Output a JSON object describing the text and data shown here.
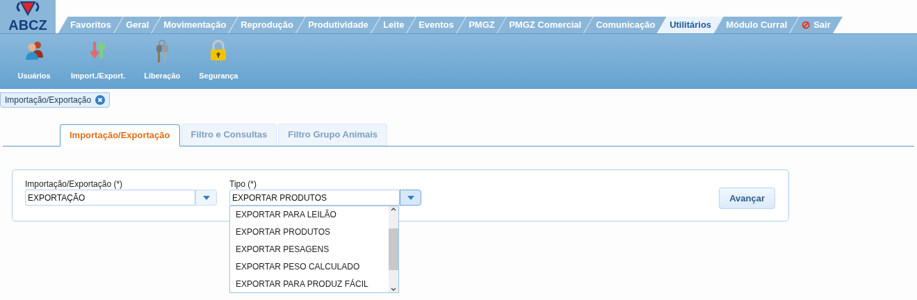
{
  "logo": {
    "text": "ABCZ"
  },
  "menu_tabs": [
    {
      "label": "Favoritos",
      "selected": false,
      "kind": "plain"
    },
    {
      "label": "Geral",
      "selected": false,
      "kind": "plain"
    },
    {
      "label": "Movimentação",
      "selected": false,
      "kind": "plain"
    },
    {
      "label": "Reprodução",
      "selected": false,
      "kind": "plain"
    },
    {
      "label": "Produtividade",
      "selected": false,
      "kind": "plain"
    },
    {
      "label": "Leite",
      "selected": false,
      "kind": "plain"
    },
    {
      "label": "Eventos",
      "selected": false,
      "kind": "plain"
    },
    {
      "label": "PMGZ",
      "selected": false,
      "kind": "plain"
    },
    {
      "label": "PMGZ Comercial",
      "selected": false,
      "kind": "plain"
    },
    {
      "label": "Comunicação",
      "selected": false,
      "kind": "plain"
    },
    {
      "label": "Utilitários",
      "selected": true,
      "kind": "plain"
    },
    {
      "label": "Módulo Curral",
      "selected": false,
      "kind": "plain"
    },
    {
      "label": "Sair",
      "selected": false,
      "kind": "exit"
    }
  ],
  "toolbar": [
    {
      "label": "Usuários",
      "kind": "users"
    },
    {
      "label": "Import./Export.",
      "kind": "arrows"
    },
    {
      "label": "Liberação",
      "kind": "keys"
    },
    {
      "label": "Segurança",
      "kind": "lock"
    }
  ],
  "document_tab": {
    "label": "Importação/Exportação"
  },
  "inner_tabs": [
    {
      "label": "Importação/Exportação",
      "selected": true
    },
    {
      "label": "Filtro e Consultas",
      "selected": false
    },
    {
      "label": "Filtro Grupo Animais",
      "selected": false
    }
  ],
  "form": {
    "fields": [
      {
        "label": "Importação/Exportação (*)",
        "value": "EXPORTAÇÃO",
        "expanded": false
      },
      {
        "label": "Tipo (*)",
        "value": "EXPORTAR PRODUTOS",
        "expanded": true
      }
    ],
    "options": [
      "EXPORTAR PARA LEILÃO",
      "EXPORTAR PRODUTOS",
      "EXPORTAR PESAGENS",
      "EXPORTAR PESO CALCULADO",
      "EXPORTAR PARA PRODUZ FÁCIL"
    ],
    "button": "Avançar"
  }
}
